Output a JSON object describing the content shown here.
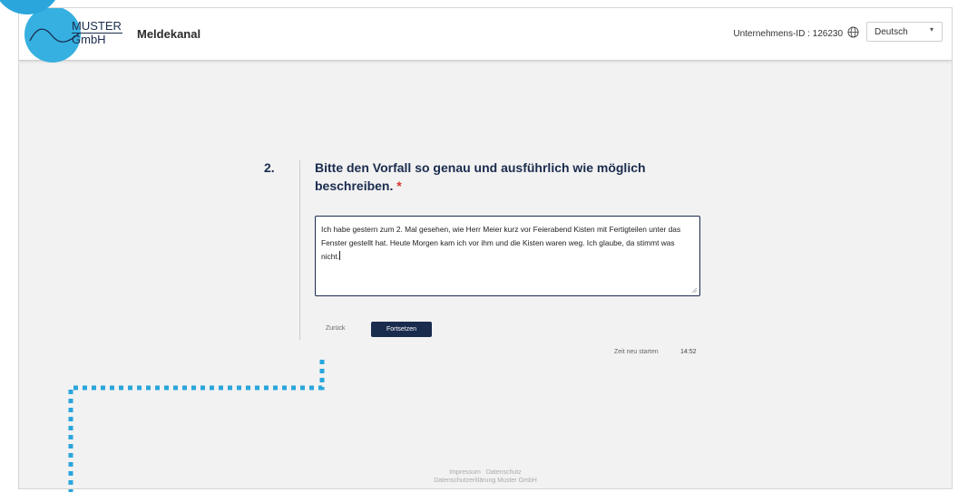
{
  "logo": {
    "line1": "MUSTER",
    "line2": "GmbH"
  },
  "header": {
    "title": "Meldekanal",
    "company_id": "Unternehmens-ID : 126230",
    "language": "Deutsch"
  },
  "question": {
    "number": "2.",
    "text": "Bitte den Vorfall so genau und ausführlich wie möglich beschreiben.",
    "required_mark": "*",
    "answer": "Ich habe gestern zum 2. Mal gesehen, wie Herr Meier kurz vor Feierabend Kisten mit Fertigteilen unter das Fenster gestellt hat. Heute Morgen kam ich vor ihm und die Kisten waren weg. Ich glaube, da stimmt was nicht."
  },
  "actions": {
    "back_label": "Zurück",
    "continue_label": "Fortsetzen"
  },
  "timer": {
    "restart_label": "Zeit neu starten",
    "value": "14:52"
  },
  "footer": {
    "links": [
      "Impressum",
      "Datenschutz"
    ],
    "privacy_statement": "Datenschutzerklärung Muster GmbH"
  },
  "colors": {
    "brand_blue": "#36b0e0",
    "navy": "#1a2c4e",
    "required_red": "#d9342b",
    "background": "#f2f2f2"
  },
  "icons": {
    "language": "globe-icon",
    "dropdown": "caret-down-icon",
    "resize": "resize-grip-icon"
  }
}
